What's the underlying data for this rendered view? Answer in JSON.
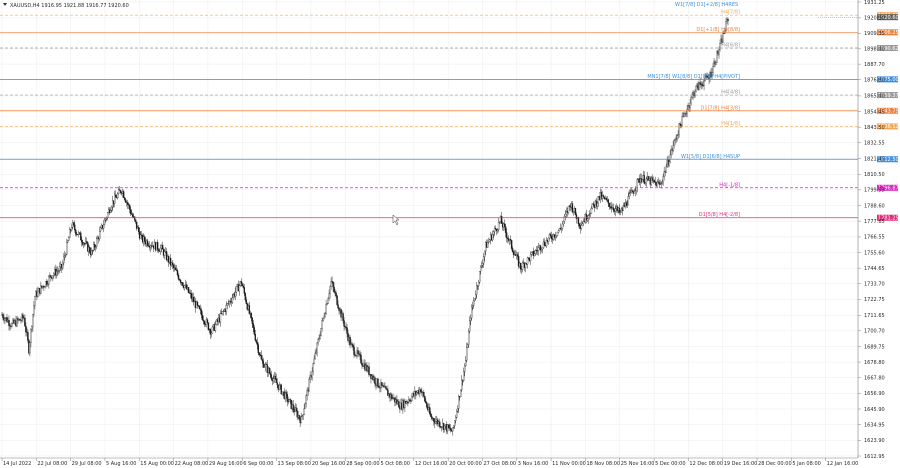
{
  "header": {
    "symbol_info": "XAUUSD,H4  1916.95 1921.88 1916.77 1920.60"
  },
  "colors": {
    "background": "#ffffff",
    "grid": "#ececec",
    "candles": "#1a1a1a",
    "orange": "#f08040",
    "orange_light": "#f5a850",
    "blue": "#3d8fe0",
    "gray": "#9a9a9a",
    "magenta": "#e020c0",
    "pink": "#e0307a",
    "price_tag": "#606060"
  },
  "price_axis": {
    "ticks": [
      "1931.25",
      "1920.10",
      "1909.35",
      "1898.40",
      "1887.70",
      "1876.80",
      "1865.40",
      "1854.45",
      "1843.50",
      "1832.55",
      "1821.45",
      "1810.50",
      "1799.55",
      "1788.60",
      "1777.65",
      "1766.55",
      "1755.60",
      "1744.65",
      "1733.70",
      "1722.75",
      "1711.65",
      "1700.70",
      "1689.75",
      "1678.80",
      "1667.80",
      "1656.90",
      "1645.90",
      "1634.95",
      "1623.90",
      "1612.95"
    ]
  },
  "time_axis": {
    "labels": [
      "14 Jul 2022",
      "22 Jul 08:00",
      "29 Jul 08:00",
      "5 Aug 16:00",
      "15 Aug 00:00",
      "22 Aug 08:00",
      "29 Aug 16:00",
      "6 Sep 00:00",
      "13 Sep 08:00",
      "20 Sep 16:00",
      "28 Sep 00:00",
      "5 Oct 08:00",
      "12 Oct 16:00",
      "20 Oct 00:00",
      "27 Oct 08:00",
      "3 Nov 16:00",
      "11 Nov 00:00",
      "18 Nov 08:00",
      "25 Nov 16:00",
      "5 Dec 00:00",
      "12 Dec 08:00",
      "19 Dec 16:00",
      "28 Dec 00:00",
      "5 Jan 08:00",
      "12 Jan 16:00"
    ]
  },
  "levels": [
    {
      "name": "level-h4-7-8",
      "label": "H4[7/8]",
      "price": 1922.0,
      "tag": "1922.00",
      "color": "#f5a850",
      "dash": true
    },
    {
      "name": "level-d1-plus1-8",
      "label": "D1[+1/8] H4[8/8]",
      "price": 1910.0,
      "tag": "1906.25",
      "color": "#f08040",
      "dash": false
    },
    {
      "name": "level-h4-6-8",
      "label": "H4[6/8]",
      "price": 1899.0,
      "tag": "1890.62",
      "color": "#9a9a9a",
      "dash": true
    },
    {
      "name": "level-mn-w1-d1-h4",
      "label": "MN1[7/8] W1[8/8] D1[8/8] H4[PIVOT]",
      "price": 1877.0,
      "tag": "1875.00",
      "color": "#3d8fe0",
      "dash": false
    },
    {
      "name": "level-h4-4-8",
      "label": "H4[4/8]",
      "price": 1866.0,
      "tag": "1859.37",
      "color": "#9a9a9a",
      "dash": true
    },
    {
      "name": "level-d1-7-8-h4-3-8",
      "label": "D1[7/8] H4[3/8]",
      "price": 1855.0,
      "tag": "1843.75",
      "color": "#f08040",
      "dash": false
    },
    {
      "name": "level-h4-1-8",
      "label": "H4[1/8]",
      "price": 1844.0,
      "tag": "1828.12",
      "color": "#f5a850",
      "dash": true
    },
    {
      "name": "level-w1-d1-h4-sup",
      "label": "W1[5/8] D1[6/8] H4SUP",
      "price": 1821.0,
      "tag": "1812.50",
      "color": "#3d8fe0",
      "dash": false
    },
    {
      "name": "level-h4-minus1-8",
      "label": "H4[-1/8]",
      "price": 1801.0,
      "tag": "1796.87",
      "color": "#e020c0",
      "dash": true
    },
    {
      "name": "level-d1-5-8-h4-minus2-8",
      "label": "D1[5/8] H4[-2/8]",
      "price": 1780.0,
      "tag": "1781.25",
      "color": "#e0307a",
      "dash": false
    }
  ],
  "top_label": "W1[7/8] D1[+2/8] H4RES",
  "current_price": {
    "value": 1920.6,
    "tag": "1920.60"
  },
  "chart_data": {
    "type": "candlestick",
    "symbol": "XAUUSD",
    "timeframe": "H4",
    "ylim": [
      1612.95,
      1931.25
    ],
    "anchors": [
      {
        "t": 0,
        "p": 1712
      },
      {
        "t": 10,
        "p": 1705
      },
      {
        "t": 22,
        "p": 1710
      },
      {
        "t": 27,
        "p": 1688
      },
      {
        "t": 33,
        "p": 1725
      },
      {
        "t": 50,
        "p": 1740
      },
      {
        "t": 60,
        "p": 1745
      },
      {
        "t": 70,
        "p": 1775
      },
      {
        "t": 90,
        "p": 1755
      },
      {
        "t": 110,
        "p": 1790
      },
      {
        "t": 120,
        "p": 1800
      },
      {
        "t": 140,
        "p": 1765
      },
      {
        "t": 160,
        "p": 1758
      },
      {
        "t": 185,
        "p": 1730
      },
      {
        "t": 210,
        "p": 1700
      },
      {
        "t": 240,
        "p": 1735
      },
      {
        "t": 260,
        "p": 1680
      },
      {
        "t": 300,
        "p": 1638
      },
      {
        "t": 330,
        "p": 1735
      },
      {
        "t": 350,
        "p": 1690
      },
      {
        "t": 375,
        "p": 1665
      },
      {
        "t": 400,
        "p": 1648
      },
      {
        "t": 420,
        "p": 1660
      },
      {
        "t": 430,
        "p": 1640
      },
      {
        "t": 452,
        "p": 1630
      },
      {
        "t": 465,
        "p": 1680
      },
      {
        "t": 470,
        "p": 1712
      },
      {
        "t": 485,
        "p": 1760
      },
      {
        "t": 500,
        "p": 1778
      },
      {
        "t": 520,
        "p": 1745
      },
      {
        "t": 540,
        "p": 1760
      },
      {
        "t": 560,
        "p": 1772
      },
      {
        "t": 570,
        "p": 1790
      },
      {
        "t": 580,
        "p": 1775
      },
      {
        "t": 600,
        "p": 1795
      },
      {
        "t": 620,
        "p": 1783
      },
      {
        "t": 640,
        "p": 1808
      },
      {
        "t": 660,
        "p": 1803
      },
      {
        "t": 680,
        "p": 1845
      },
      {
        "t": 695,
        "p": 1870
      },
      {
        "t": 710,
        "p": 1880
      },
      {
        "t": 720,
        "p": 1900
      },
      {
        "t": 728,
        "p": 1920
      }
    ]
  }
}
